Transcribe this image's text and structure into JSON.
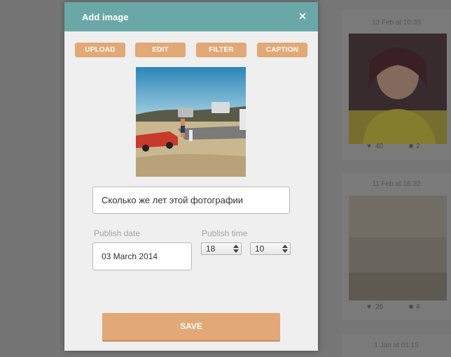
{
  "modal": {
    "title": "Add image",
    "close_icon": "close-icon",
    "toolbar": {
      "upload": "UPLOAD",
      "edit": "EDIT",
      "filter": "FILTER",
      "caption": "CAPTION"
    },
    "caption_value": "Сколько же лет этой фотографии",
    "publish_date": {
      "label": "Publish date",
      "value": "03 March 2014"
    },
    "publish_time": {
      "label": "Publish time",
      "hour": "18",
      "minute": "10"
    },
    "save_label": "SAVE"
  },
  "feed": {
    "cards": [
      {
        "stamp": "13 Feb at 10:36",
        "likes": "40",
        "comments": "2"
      },
      {
        "stamp": "11 Feb at 16:32",
        "likes": "26",
        "comments": "4"
      },
      {
        "stamp": "1 Jan at 01:15"
      }
    ]
  },
  "colors": {
    "header": "#6aa8a8",
    "accent": "#e2a875",
    "modal_bg": "#efefef",
    "backdrop": "#7b7b7b"
  }
}
